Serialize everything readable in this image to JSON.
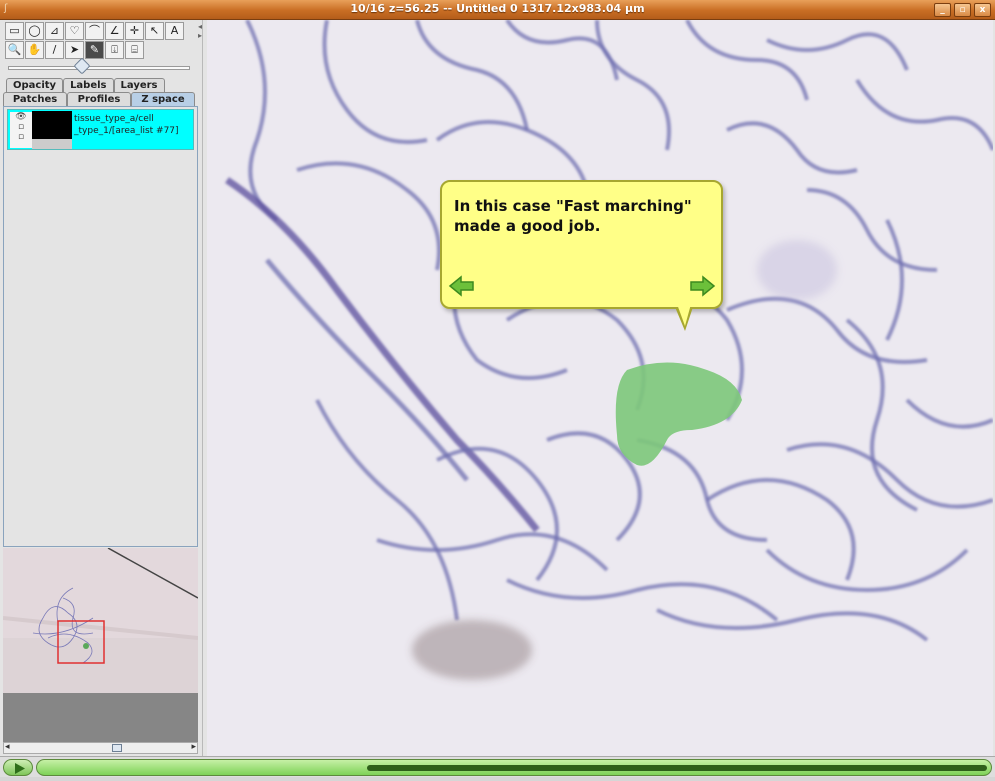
{
  "window": {
    "title": "10/16 z=56.25 -- Untitled 0  1317.12x983.04 µm",
    "app_icon": "fiji-icon",
    "buttons": {
      "minimize": "_",
      "maximize": "▫",
      "close": "x"
    }
  },
  "toolbar": {
    "row1": [
      {
        "name": "rectangle-tool-icon",
        "glyph": "▭"
      },
      {
        "name": "oval-tool-icon",
        "glyph": "◯"
      },
      {
        "name": "polygon-tool-icon",
        "glyph": "⊿"
      },
      {
        "name": "freehand-tool-icon",
        "glyph": "♡"
      },
      {
        "name": "polyline-tool-icon",
        "glyph": "⌒"
      },
      {
        "name": "angle-tool-icon",
        "glyph": "∠"
      },
      {
        "name": "point-tool-icon",
        "glyph": "✛"
      },
      {
        "name": "wand-tool-icon",
        "glyph": "↖"
      },
      {
        "name": "text-tool-icon",
        "glyph": "A"
      }
    ],
    "row2": [
      {
        "name": "magnifier-tool-icon",
        "glyph": "🔍"
      },
      {
        "name": "hand-tool-icon",
        "glyph": "✋"
      },
      {
        "name": "dropper-tool-icon",
        "glyph": "/"
      },
      {
        "name": "arrow-tool-icon",
        "glyph": "➤"
      },
      {
        "name": "pen-tool-icon",
        "glyph": "✎",
        "active": true
      },
      {
        "name": "fill-tool-icon",
        "glyph": "⍗"
      },
      {
        "name": "align-tool-icon",
        "glyph": "⌸"
      }
    ]
  },
  "tabs_row1": [
    "Opacity",
    "Labels",
    "Layers"
  ],
  "tabs_row2": [
    "Patches",
    "Profiles",
    "Z space"
  ],
  "selected_tab": "Z space",
  "layer_item": {
    "label": "tissue_type_a/cell _type_1/[area_list #77]",
    "visibility_icon": "eye-icon"
  },
  "tooltip": {
    "text": "In this case \"Fast marching\" made a good job.",
    "prev_icon": "arrow-left-icon",
    "next_icon": "arrow-right-icon"
  },
  "playback": {
    "progress_percent": 65,
    "play_icon": "play-icon"
  },
  "colors": {
    "titlebar": "#c96e24",
    "selected_item": "#00ffff",
    "tooltip_bg": "#ffff87",
    "segmentation": "#7dc87a",
    "progress": "#7ed257"
  }
}
